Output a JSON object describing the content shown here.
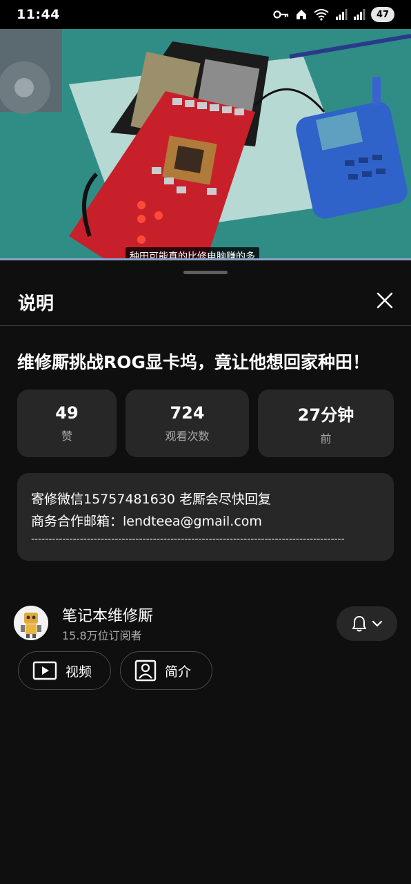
{
  "status_bar": {
    "time": "11:44",
    "battery": "47",
    "icons": [
      "key-icon",
      "home-icon",
      "wifi-icon",
      "signal-icon",
      "signal-icon",
      "battery-icon"
    ]
  },
  "video": {
    "subtitle": "种田可能真的比修电脑赚的多"
  },
  "sheet": {
    "title": "说明",
    "close_icon": "close-icon"
  },
  "video_title": "维修厮挑战ROG显卡坞，竟让他想回家种田！",
  "stats": [
    {
      "value": "49",
      "label": "赞"
    },
    {
      "value": "724",
      "label": "观看次数"
    },
    {
      "value": "27分钟",
      "label": "前"
    }
  ],
  "description": {
    "line1": "寄修微信15757481630 老厮会尽快回复",
    "line2": "商务合作邮箱：lendteea@gmail.com",
    "separator": "------------------------------------------------------------------------------------------"
  },
  "channel": {
    "name": "笔记本维修厮",
    "subscribers": "15.8万位订阅者",
    "bell_icon": "bell-icon",
    "chevron_icon": "chevron-down-icon"
  },
  "buttons": {
    "videos_label": "视频",
    "about_label": "简介"
  },
  "colors": {
    "background": "#0f0f0f",
    "card": "#272727",
    "secondary_text": "#aaaaaa"
  }
}
